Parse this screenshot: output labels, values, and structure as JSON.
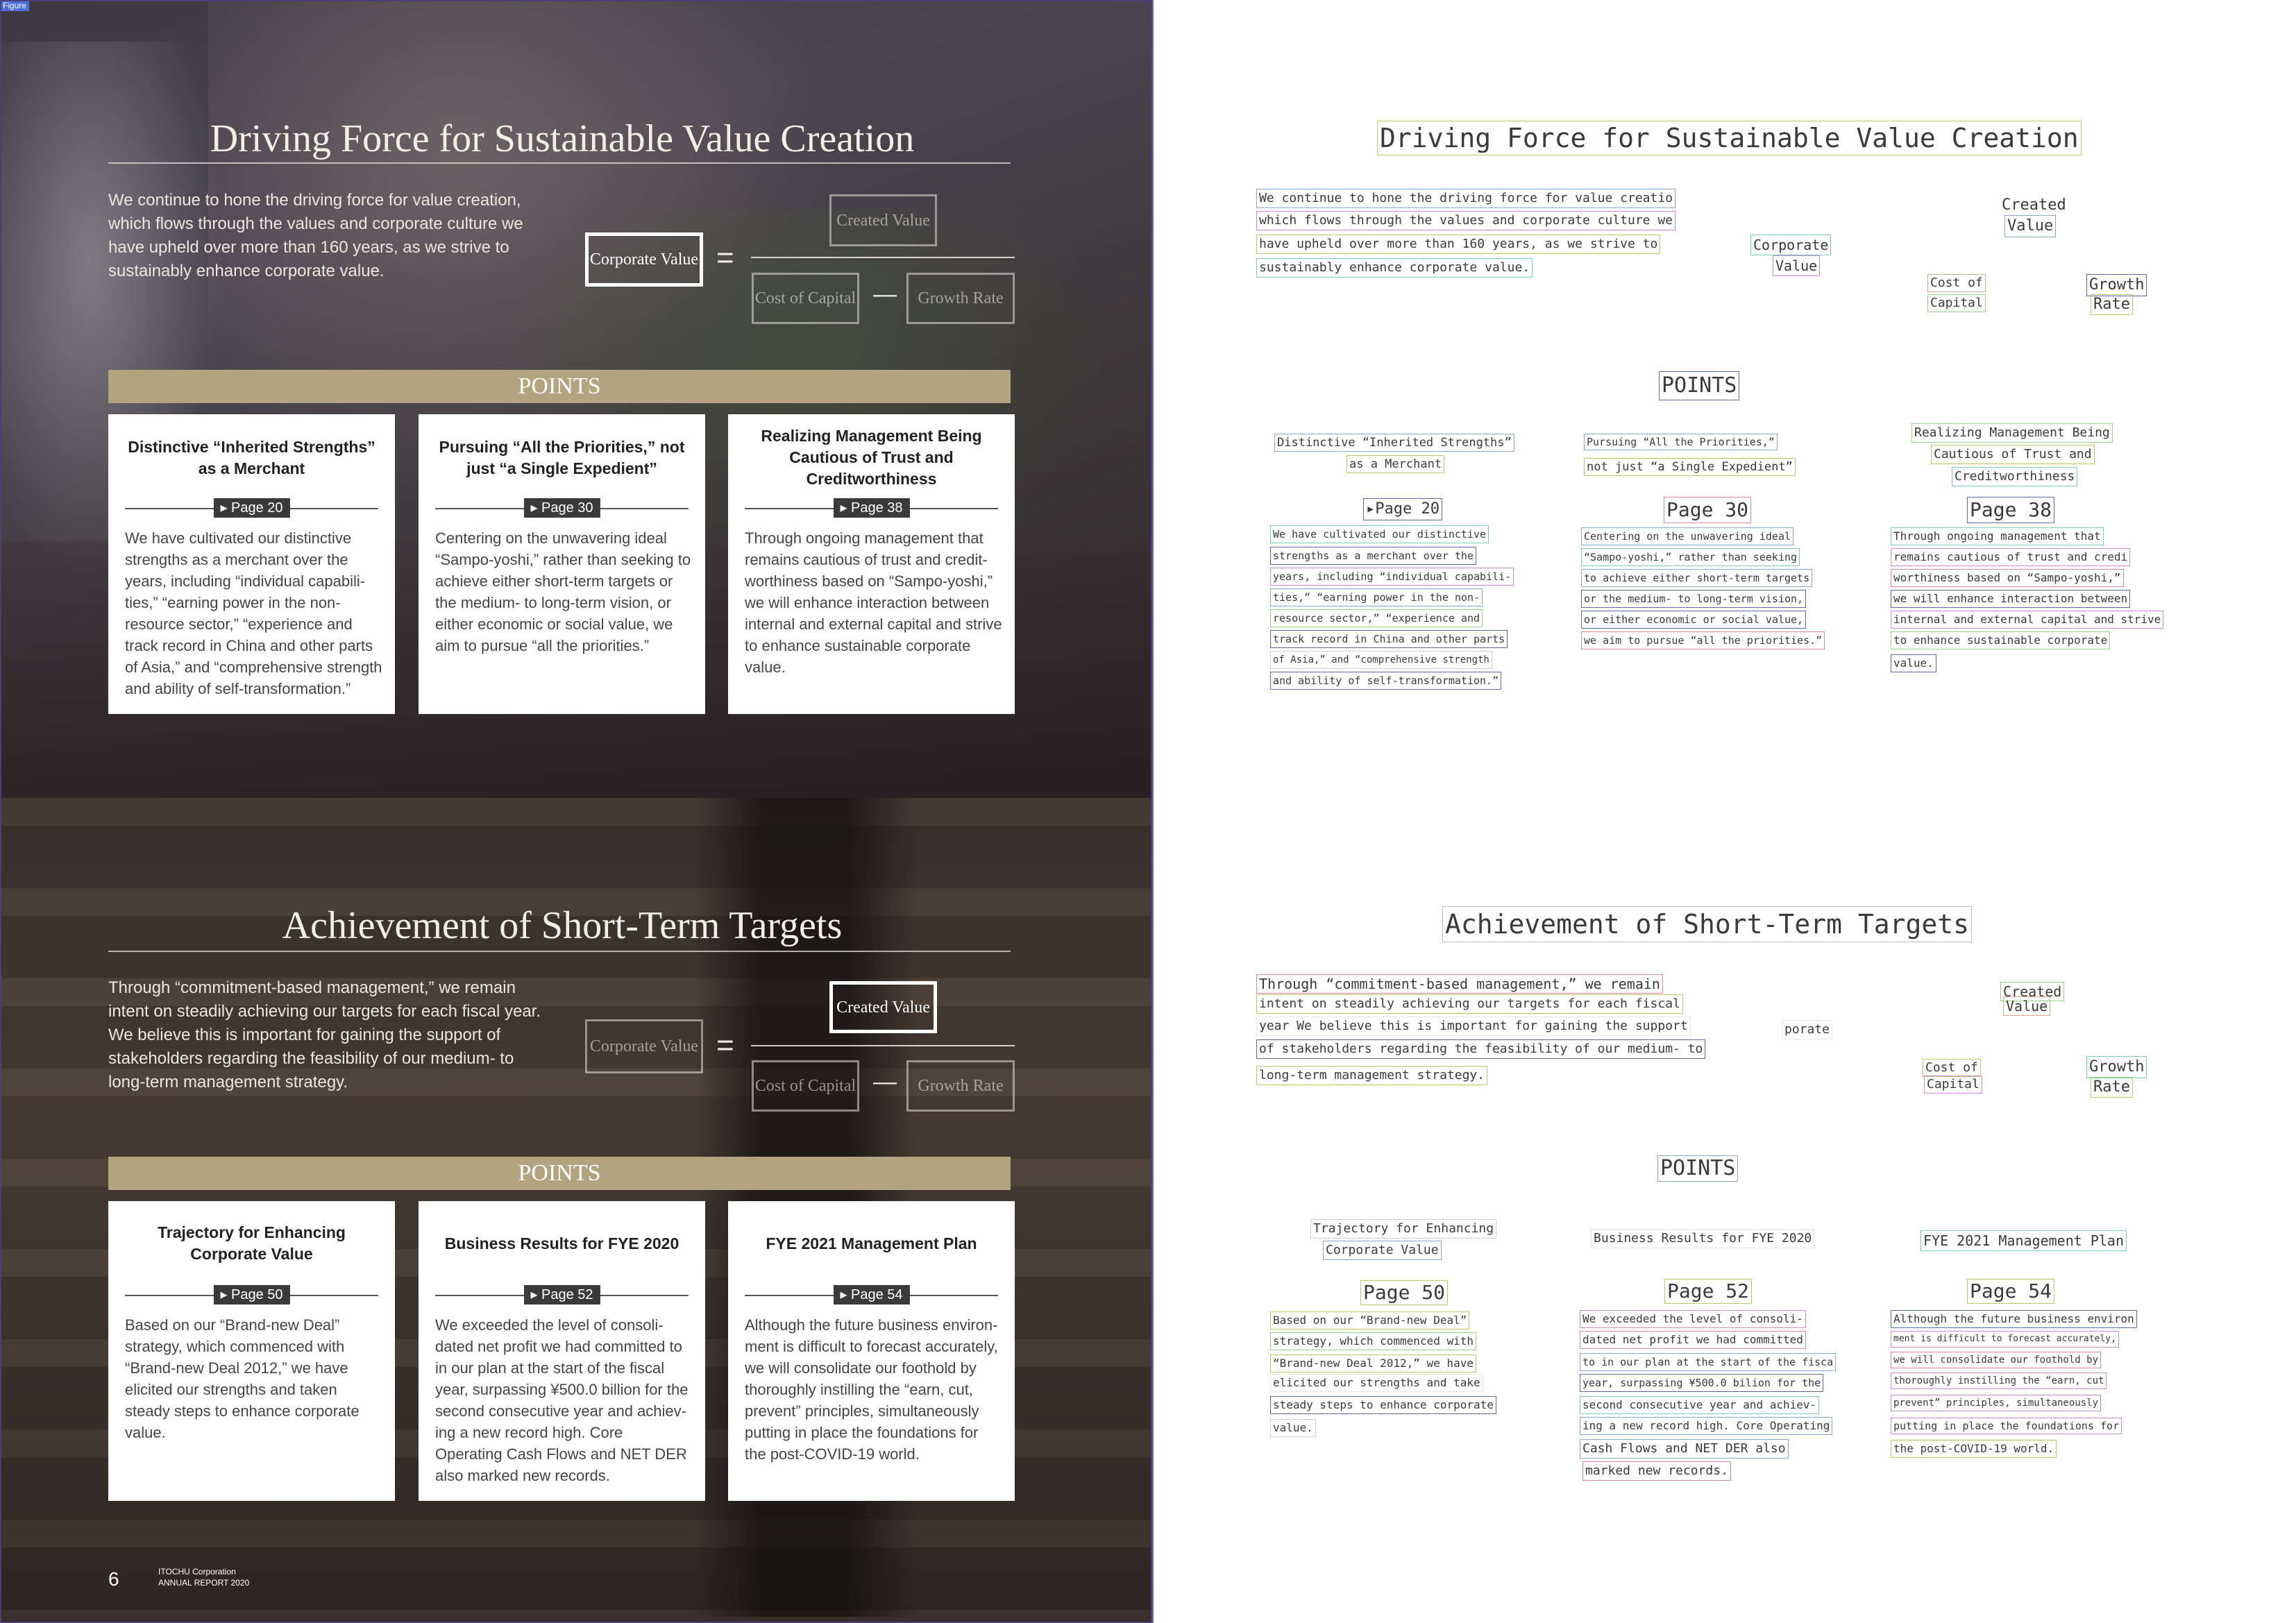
{
  "figure_tag": "Figure",
  "left": {
    "sections": [
      {
        "title": "Driving Force for Sustainable Value Creation",
        "intro": "We continue to hone the driving force for value creation, which flows through the values and corporate culture we have upheld over more than 160 years, as we strive to sustainably enhance corporate value.",
        "formula": {
          "corporate_value": "Corporate Value",
          "created_value": "Created Value",
          "cost_of_capital": "Cost of Capital",
          "growth_rate": "Growth Rate",
          "equals": "=",
          "minus": "—",
          "active": "corporate_value"
        },
        "points_label": "POINTS",
        "cards": [
          {
            "title": "Distinctive “Inherited Strengths” as a Merchant",
            "page": "▸ Page 20",
            "body": "We have cultivated our distinctive strengths as a merchant over the years, including “individual capabili-ties,” “earning power in the non-resource sector,” “experience and track record in China and other parts of Asia,” and “comprehensive strength and ability of self-transformation.”"
          },
          {
            "title": "Pursuing “All the Priorities,” not just “a Single Expedient”",
            "page": "▸ Page 30",
            "body": "Centering on the unwavering ideal “Sampo-yoshi,” rather than seeking to achieve either short-term targets or the medium- to long-term vision, or either economic or social value, we aim to pursue “all the priorities.”"
          },
          {
            "title": "Realizing Management Being Cautious of Trust and Creditworthiness",
            "page": "▸ Page 38",
            "body": "Through ongoing management that remains cautious of trust and credit-worthiness based on “Sampo-yoshi,” we will enhance interaction between internal and external capital and strive to enhance sustainable corporate value."
          }
        ]
      },
      {
        "title": "Achievement of Short-Term Targets",
        "intro": "Through “commitment-based management,” we remain intent on steadily achieving our targets for each fiscal year. We believe this is important for gaining the support of stakeholders regarding the feasibility of our medium- to long-term management strategy.",
        "formula": {
          "corporate_value": "Corporate Value",
          "created_value": "Created Value",
          "cost_of_capital": "Cost of Capital",
          "growth_rate": "Growth Rate",
          "equals": "=",
          "minus": "—",
          "active": "created_value"
        },
        "points_label": "POINTS",
        "cards": [
          {
            "title": "Trajectory for Enhancing Corporate Value",
            "page": "▸ Page 50",
            "body": "Based on our “Brand-new Deal” strategy, which commenced with “Brand-new Deal 2012,” we have elicited our strengths and taken steady steps to enhance corporate value."
          },
          {
            "title": "Business Results for FYE 2020",
            "page": "▸ Page 52",
            "body": "We exceeded the level of consoli-dated net profit we had committed to in our plan at the start of the fiscal year, surpassing ¥500.0 billion for the second consecutive year and achiev-ing a new record high. Core Operating Cash Flows and NET DER also marked new records."
          },
          {
            "title": "FYE 2021 Management Plan",
            "page": "▸ Page 54",
            "body": "Although the future business environ-ment is difficult to forecast accurately, we will consolidate our foothold by thoroughly instilling the “earn, cut, prevent” principles, simultaneously putting in place the foundations for the post-COVID-19 world."
          }
        ]
      }
    ],
    "footer": {
      "page_number": "6",
      "company": "ITOCHU Corporation",
      "report": "ANNUAL REPORT 2020"
    }
  },
  "right": {
    "s1": {
      "title": "Driving Force for Sustainable Value Creation",
      "intro_lines": [
        "We continue to hone the driving force for value creatio",
        "which flows through the values and corporate culture we",
        "have upheld over more than 160 years, as we strive to",
        "sustainably enhance corporate value."
      ],
      "created": "Created",
      "value": "Value",
      "corporate": "Corporate",
      "value2": "Value",
      "cost_of": "Cost of",
      "capital": "Capital",
      "growth": "Growth",
      "rate": "Rate",
      "points": "POINTS",
      "card1_title": [
        "Distinctive “Inherited Strengths”",
        "as a Merchant"
      ],
      "card2_title": [
        "Pursuing “All the Priorities,”",
        "not just “a Single Expedient”"
      ],
      "card3_title": [
        "Realizing Management Being",
        "Cautious of Trust and",
        "Creditworthiness"
      ],
      "page1": "▸Page 20",
      "page2": "Page 30",
      "page3": "Page 38",
      "card1_lines": [
        "We have cultivated our distinctive",
        "strengths as a merchant over the",
        "years, including “individual capabili-",
        "ties,” “earning power in the non-",
        "resource sector,” “experience and",
        "track record in China and other parts",
        "of Asia,” and “comprehensive strength",
        "and ability of self-transformation.”"
      ],
      "card2_lines": [
        "Centering on the unwavering ideal",
        "“Sampo-yoshi,” rather than seeking",
        "to achieve either short-term targets",
        "or the medium- to long-term vision,",
        "or either economic or social value,",
        "we aim to pursue “all the priorities.”"
      ],
      "card3_lines": [
        "Through ongoing management that",
        "remains cautious of trust and credi",
        "worthiness based on “Sampo-yoshi,”",
        "we will enhance interaction between",
        "internal and external capital and strive",
        "to enhance sustainable corporate",
        "value."
      ]
    },
    "s2": {
      "title": "Achievement of Short-Term Targets",
      "intro_lines": [
        "Through “commitment-based management,” we remain",
        "intent on steadily achieving our targets for each fiscal",
        "year We believe this is important for gaining the support",
        "of stakeholders regarding the feasibility of our medium- to",
        "long-term management strategy."
      ],
      "created": "Created",
      "value": "Value",
      "porate": "porate",
      "cost_of": "Cost of",
      "capital": "Capital",
      "growth": "Growth",
      "rate": "Rate",
      "points": "POINTS",
      "card1_title": [
        "Trajectory for Enhancing",
        "Corporate Value"
      ],
      "card2_title": [
        "Business Results for FYE 2020"
      ],
      "card3_title": [
        "FYE 2021 Management Plan"
      ],
      "page1": "Page 50",
      "page2": "Page 52",
      "page3": "Page 54",
      "card1_lines": [
        "Based on our “Brand-new Deal”",
        "strategy, which commenced with",
        "“Brand-new Deal 2012,” we have",
        "elicited our strengths and take",
        "steady steps to enhance corporate",
        "value."
      ],
      "card2_lines": [
        "We exceeded the level of consoli-",
        "dated net profit we had committed",
        "to in our plan at the start of the fisca",
        "year, surpassing ¥500.0 bilion for the",
        "second consecutive year and achiev-",
        "ing a new record high. Core Operating",
        "Cash Flows and NET DER also",
        "marked new records."
      ],
      "card3_lines": [
        "Although the future business environ",
        "ment is difficult to forecast accurately,",
        "we will consolidate our foothold by",
        "thoroughly instilling the “earn, cut",
        "prevent” principles, simultaneously",
        "putting in place the foundations for",
        "the post-COVID-19 world."
      ]
    }
  }
}
